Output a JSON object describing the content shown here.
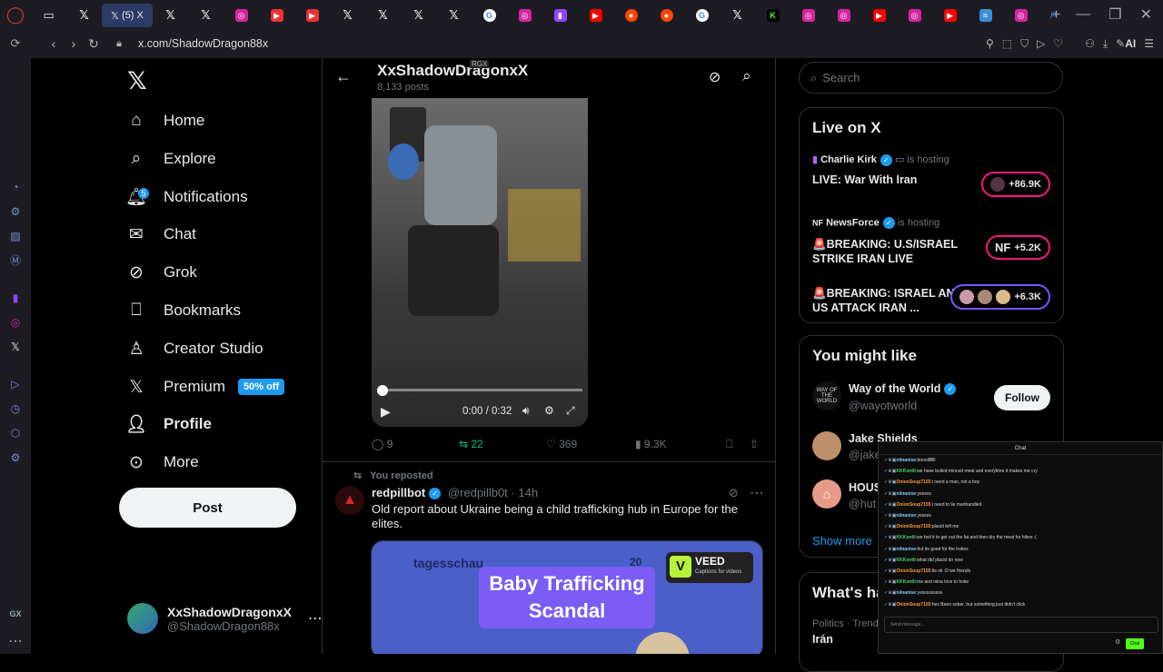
{
  "browser": {
    "active_tab_label": "(5) X",
    "url": "x.com/ShadowDragon88x",
    "ai_label": "AI",
    "sidebar_gx_label": "GX"
  },
  "nav": {
    "items": [
      {
        "label": "Home",
        "icon": "home-icon"
      },
      {
        "label": "Explore",
        "icon": "search-icon"
      },
      {
        "label": "Notifications",
        "icon": "bell-icon",
        "badge": "5"
      },
      {
        "label": "Chat",
        "icon": "mail-icon"
      },
      {
        "label": "Grok",
        "icon": "grok-icon"
      },
      {
        "label": "Bookmarks",
        "icon": "bookmark-icon"
      },
      {
        "label": "Creator Studio",
        "icon": "creator-icon"
      },
      {
        "label": "Premium",
        "icon": "x-icon",
        "promo": "50% off"
      },
      {
        "label": "Profile",
        "icon": "person-icon"
      },
      {
        "label": "More",
        "icon": "more-icon"
      }
    ],
    "post_button": "Post",
    "profile": {
      "name": "XxShadowDragonxX",
      "handle": "@ShadowDragon88x"
    }
  },
  "header": {
    "title": "XxShadowDragonxX",
    "subtitle": "8,133 posts",
    "overlay": "RGX"
  },
  "video": {
    "time": "0:00 / 0:32",
    "progress": 0.0
  },
  "tweet1_actions": {
    "replies": "9",
    "reposts": "22",
    "likes": "369",
    "views": "9.3K"
  },
  "tweet2": {
    "reposted_label": "You reposted",
    "author": "redpillbot",
    "handle": "@redpillb0t",
    "time": "· 14h",
    "text": "Old report about Ukraine being a child trafficking hub in Europe for the elites.",
    "media_source": "tagesschau",
    "media_number": "20",
    "media_caption": "Baby Trafficking Scandal",
    "veed_title": "VEED",
    "veed_sub": "Captions for videos"
  },
  "right": {
    "search_placeholder": "Search",
    "live_title": "Live on X",
    "live": [
      {
        "host": "Charlie Kirk",
        "status": "is hosting",
        "title": "LIVE: War With Iran",
        "count": "+86.9K"
      },
      {
        "host": "NewsForce",
        "status": "is hosting",
        "title": "🚨BREAKING: U.S/ISRAEL STRIKE IRAN LIVE",
        "count": "+5.2K",
        "avatar": "NF"
      },
      {
        "host": "",
        "status": "",
        "title": "🚨BREAKING: ISRAEL AND US ATTACK IRAN ...",
        "count": "+6.3K"
      }
    ],
    "might_like_title": "You might like",
    "suggestions": [
      {
        "name": "Way of the World",
        "handle": "@wayotworld",
        "button": "Follow"
      },
      {
        "name": "Jake Shields",
        "handle": "@jake",
        "button": "Follow"
      },
      {
        "name": "HOUS",
        "handle": "@hut",
        "button": "Follow"
      }
    ],
    "show_more": "Show more",
    "happening_title": "What's ha",
    "trend_meta": "Politics · Trend",
    "trend_name": "Irán"
  },
  "chat": {
    "title": "Chat",
    "placeholder": "Send message...",
    "send": "Chat",
    "lines": [
      {
        "user": "niinanise",
        "color": "#7fd0ff",
        "text": "booollllllll"
      },
      {
        "user": "KKKontli",
        "color": "#4fd36a",
        "text": "we have boiled minced meat and everytime it makes me cry"
      },
      {
        "user": "OnionSoup7155",
        "color": "#ff9a3c",
        "text": "i need a man, not a boy"
      },
      {
        "user": "niinanise",
        "color": "#7fd0ff",
        "text": "yeesss"
      },
      {
        "user": "OnionSoup7155",
        "color": "#ff9a3c",
        "text": "i need to lie manhandled"
      },
      {
        "user": "niinanise",
        "color": "#7fd0ff",
        "text": "yessss"
      },
      {
        "user": "OnionSoup7155",
        "color": "#ff9a3c",
        "text": "placid left me"
      },
      {
        "user": "KKKontli",
        "color": "#4fd36a",
        "text": "we boil it to get out the fat and then dry the meat for hikes :("
      },
      {
        "user": "niinanise",
        "color": "#7fd0ff",
        "text": "but its good for the hokes"
      },
      {
        "user": "KKKontli",
        "color": "#4fd36a",
        "text": "what did placid do now"
      },
      {
        "user": "OnionSoup7155",
        "color": "#ff9a3c",
        "text": "its ok :D we friends"
      },
      {
        "user": "KKKontli",
        "color": "#4fd36a",
        "text": "me and niina love to hoke"
      },
      {
        "user": "niinanise",
        "color": "#7fd0ff",
        "text": "yesssssssss"
      },
      {
        "user": "OnionSoup7155",
        "color": "#ff9a3c",
        "text": "hes Been sober, but something just didn't click"
      }
    ]
  },
  "colors": {
    "accent": "#1d9bf0",
    "repost": "#00ba7c",
    "live_border": "#f91880"
  }
}
